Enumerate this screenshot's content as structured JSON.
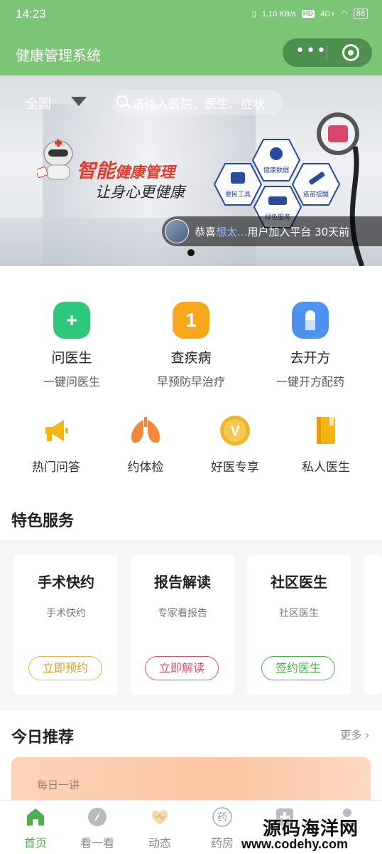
{
  "status_bar": {
    "time": "14:23",
    "net_speed": "1.10 KB/s",
    "hd": "HD",
    "signal": "4G+",
    "battery": "88"
  },
  "title_bar": {
    "title": "健康管理系统",
    "more_glyph": "•••"
  },
  "banner": {
    "region": "全国",
    "search_placeholder": "请输入医院、医生、症状",
    "slogan_main_a": "智能",
    "slogan_main_b": "健康管理",
    "slogan_sub": "让身心更健康",
    "hex_labels": [
      "健康数据",
      "便民工具",
      "疫苗提醒",
      "绿色服务"
    ],
    "toast_prefix": "恭喜",
    "toast_user": "想太...",
    "toast_suffix": "用户加入平台 30天前"
  },
  "main_entries": [
    {
      "title": "问医生",
      "sub": "一键问医生",
      "glyph": "+",
      "color": "#2ec87a"
    },
    {
      "title": "查疾病",
      "sub": "早预防早治疗",
      "glyph": "1",
      "color": "#f7a81b"
    },
    {
      "title": "去开方",
      "sub": "一键开方配药",
      "glyph": "",
      "color": "#4e92f0"
    }
  ],
  "small_entries": [
    {
      "title": "热门问答",
      "icon": "megaphone-icon"
    },
    {
      "title": "约体检",
      "icon": "lungs-icon"
    },
    {
      "title": "好医专享",
      "icon": "vip-badge-icon"
    },
    {
      "title": "私人医生",
      "icon": "notebook-icon"
    }
  ],
  "features_section": {
    "title": "特色服务"
  },
  "features": [
    {
      "title": "手术快约",
      "sub": "手术快约",
      "button": "立即预约",
      "color": "#e6b84a"
    },
    {
      "title": "报告解读",
      "sub": "专家看报告",
      "button": "立即解读",
      "color": "#d9547a"
    },
    {
      "title": "社区医生",
      "sub": "社区医生",
      "button": "签约医生",
      "color": "#4caf50"
    }
  ],
  "recommend": {
    "title": "今日推荐",
    "more": "更多",
    "card_text": "每日一讲"
  },
  "tabbar": [
    {
      "label": "首页",
      "icon": "home-icon",
      "active": true
    },
    {
      "label": "看一看",
      "icon": "compass-icon",
      "active": false
    },
    {
      "label": "动态",
      "icon": "heart-icon",
      "active": false
    },
    {
      "label": "药房",
      "icon": "pharmacy-icon",
      "active": false
    },
    {
      "label": "",
      "icon": "add-icon",
      "active": false
    },
    {
      "label": "",
      "icon": "user-icon",
      "active": false
    }
  ],
  "watermark": {
    "line1": "源码海洋网",
    "line2": "www.codehy.com"
  },
  "colors": {
    "brand_green": "#7cc476",
    "active_tab": "#4caf50"
  }
}
